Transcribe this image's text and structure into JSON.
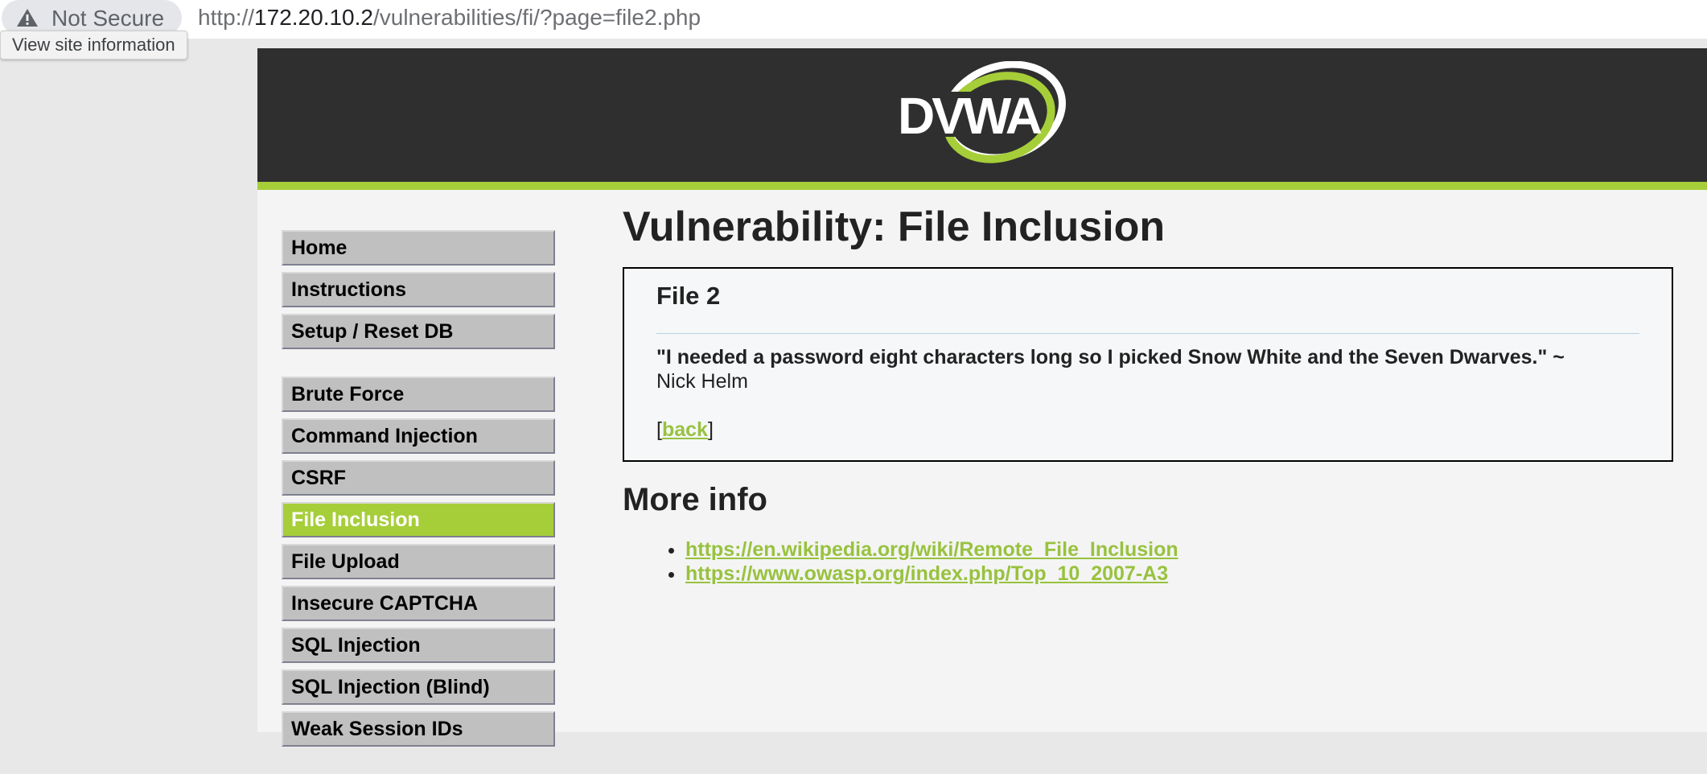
{
  "browser": {
    "security_label": "Not Secure",
    "url_scheme": "http://",
    "url_host": "172.20.10.2",
    "url_path": "/vulnerabilities/fi/?page=file2.php",
    "tooltip": "View site information",
    "warning_icon": "warning-triangle-icon"
  },
  "header": {
    "logo_text": "DVWA",
    "logo_colors": {
      "text": "#ffffff",
      "swoosh": "#a6ce39"
    },
    "accent_color": "#a6ce39",
    "background_color": "#2f2f2f"
  },
  "menu": {
    "groups": [
      [
        {
          "label": "Home",
          "selected": false
        },
        {
          "label": "Instructions",
          "selected": false
        },
        {
          "label": "Setup / Reset DB",
          "selected": false
        }
      ],
      [
        {
          "label": "Brute Force",
          "selected": false
        },
        {
          "label": "Command Injection",
          "selected": false
        },
        {
          "label": "CSRF",
          "selected": false
        },
        {
          "label": "File Inclusion",
          "selected": true
        },
        {
          "label": "File Upload",
          "selected": false
        },
        {
          "label": "Insecure CAPTCHA",
          "selected": false
        },
        {
          "label": "SQL Injection",
          "selected": false
        },
        {
          "label": "SQL Injection (Blind)",
          "selected": false
        },
        {
          "label": "Weak Session IDs",
          "selected": false
        }
      ]
    ],
    "selected_color": "#a6ce39"
  },
  "main": {
    "title": "Vulnerability: File Inclusion",
    "file_heading": "File 2",
    "quote": "\"I needed a password eight characters long so I picked Snow White and the Seven Dwarves.\" ~",
    "quote_author": "Nick Helm",
    "back_open": "[",
    "back_link": "back",
    "back_close": "]",
    "more_info_title": "More info",
    "more_info_links": [
      "https://en.wikipedia.org/wiki/Remote_File_Inclusion",
      "https://www.owasp.org/index.php/Top_10_2007-A3"
    ]
  }
}
